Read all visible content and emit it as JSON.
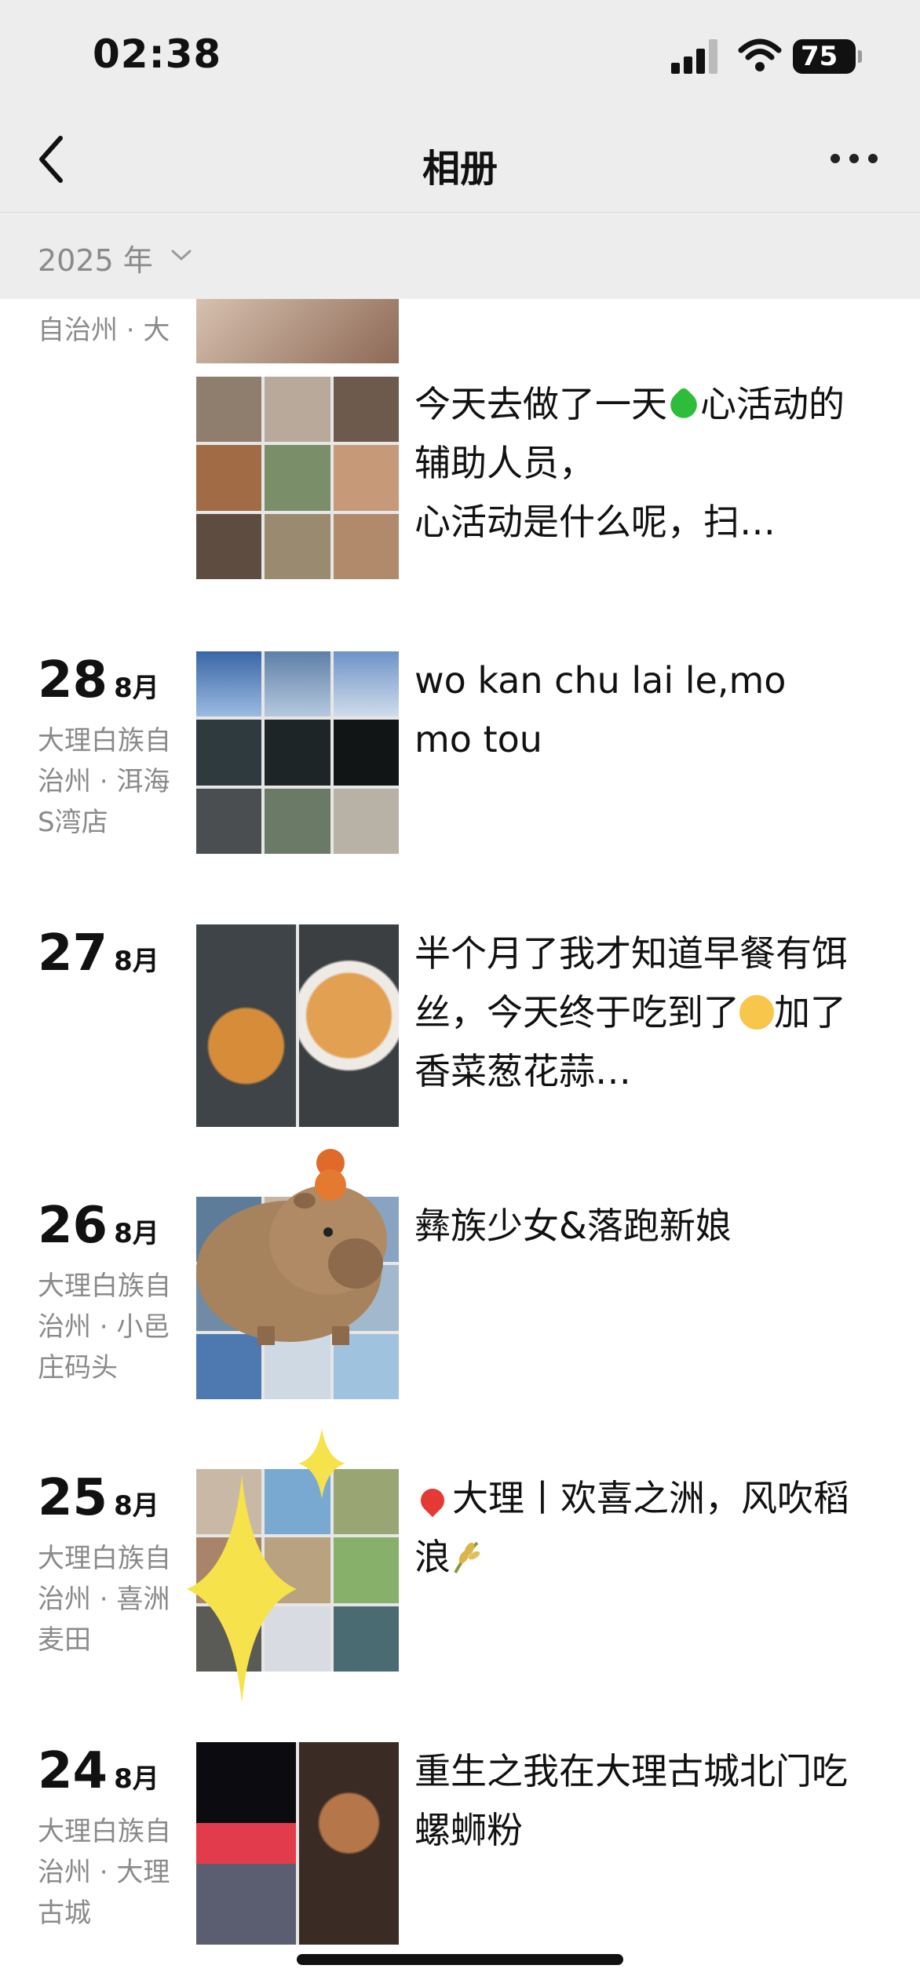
{
  "status_bar": {
    "time": "02:38",
    "battery": "75"
  },
  "nav": {
    "title": "相册"
  },
  "year_filter": {
    "label": "2025 年"
  },
  "colors": {
    "header_bg": "#ededed",
    "secondary_text": "#8a8a8a",
    "heart_green": "#2ebd3a"
  },
  "entries": [
    {
      "location": "自治州 · 大理古城",
      "caption_a": "今天去做了一天",
      "caption_b": "心活动的辅助人员，",
      "caption_c": "心活动是什么呢，扫…"
    },
    {
      "day": "28",
      "month": "8月",
      "location": "大理白族自治州 · 洱海S湾店",
      "caption": "wo kan chu lai le,mo mo tou"
    },
    {
      "day": "27",
      "month": "8月",
      "caption_a": "半个月了我才知道早餐有饵丝，今天终于吃到了",
      "caption_b": "加了香菜葱花蒜…"
    },
    {
      "day": "26",
      "month": "8月",
      "location": "大理白族自治州 · 小邑庄码头",
      "caption": "彝族少女&落跑新娘"
    },
    {
      "day": "25",
      "month": "8月",
      "location": "大理白族自治州 · 喜洲麦田",
      "caption_a": "大理丨欢喜之洲，风吹稻浪"
    },
    {
      "day": "24",
      "month": "8月",
      "location": "大理白族自治州 · 大理古城",
      "caption": "重生之我在大理古城北门吃螺蛳粉"
    }
  ]
}
